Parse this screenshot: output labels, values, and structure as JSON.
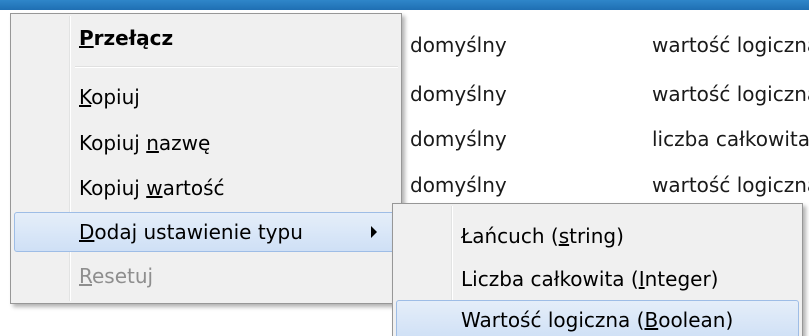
{
  "background_rows": [
    {
      "status": "domyślny",
      "type": "wartość logiczna"
    },
    {
      "status": "domyślny",
      "type": "wartość logiczna"
    },
    {
      "status": "domyślny",
      "type": "liczba całkowita"
    },
    {
      "status": "domyślny",
      "type": "wartość logiczna"
    }
  ],
  "context_menu": {
    "items": [
      {
        "id": "toggle",
        "before": "",
        "accel": "P",
        "after": "rzełącz",
        "bold": true,
        "disabled": false
      },
      {
        "id": "copy",
        "before": "",
        "accel": "K",
        "after": "opiuj",
        "disabled": false
      },
      {
        "id": "copy-name",
        "before": "Kopiuj ",
        "accel": "n",
        "after": "azwę",
        "disabled": false
      },
      {
        "id": "copy-value",
        "before": "Kopiuj ",
        "accel": "w",
        "after": "artość",
        "disabled": false
      },
      {
        "id": "add-setting",
        "before": "",
        "accel": "D",
        "after": "odaj ustawienie typu",
        "highlighted": true,
        "has_submenu": true
      },
      {
        "id": "reset",
        "before": "",
        "accel": "R",
        "after": "esetuj",
        "disabled": true
      }
    ]
  },
  "submenu": {
    "items": [
      {
        "id": "string",
        "before": "Łańcuch (",
        "accel": "s",
        "after": "tring)"
      },
      {
        "id": "integer",
        "before": "Liczba całkowita (",
        "accel": "I",
        "after": "nteger)"
      },
      {
        "id": "boolean",
        "before": "Wartość logiczna (",
        "accel": "B",
        "after": "oolean)",
        "highlighted": true
      }
    ]
  },
  "colors": {
    "title_bar": "#1f6fb3",
    "menu_background": "#f0f0f0",
    "highlight_border": "#9ebde6",
    "disabled_text": "#8e8e8e"
  }
}
